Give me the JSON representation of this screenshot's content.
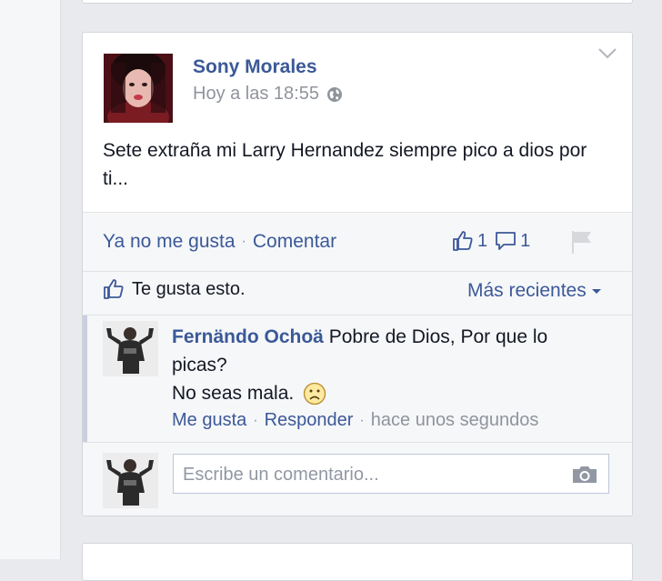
{
  "post": {
    "author": "Sony Morales",
    "timestamp": "Hoy a las 18:55",
    "privacy_icon": "globe-icon",
    "text": "Sete extraña mi Larry Hernandez siempre pico a dios por ti...",
    "options_icon": "chevron-down-icon"
  },
  "ufi": {
    "unlike_label": "Ya no me gusta",
    "comment_label": "Comentar",
    "separator": "·",
    "like_count": "1",
    "comment_count": "1",
    "likes_text": "Te gusta esto.",
    "sort_label": "Más recientes"
  },
  "comment": {
    "author": "Fernändo Ochoä",
    "text_line1": "Pobre de Dios, Por que lo picas?",
    "text_line2": "No seas mala.",
    "emoticon": "frown-icon",
    "like_label": "Me gusta",
    "reply_label": "Responder",
    "time": "hace unos segundos"
  },
  "composer": {
    "placeholder": "Escribe un comentario...",
    "photo_icon": "camera-icon"
  },
  "colors": {
    "link": "#3b5998",
    "meta": "#90949c",
    "background": "#e9eaed"
  }
}
